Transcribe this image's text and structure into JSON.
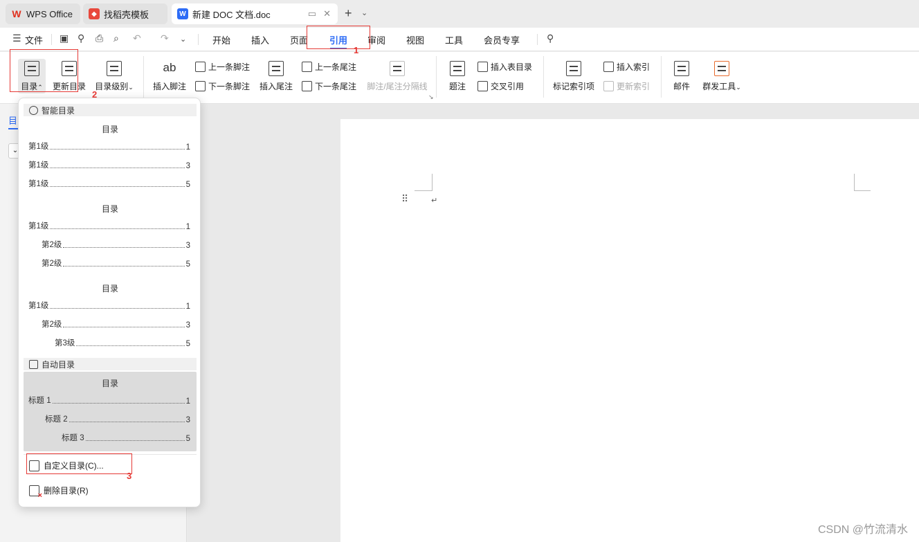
{
  "tabs": [
    {
      "label": "WPS Office",
      "icon": "wps-logo-icon"
    },
    {
      "label": "找稻壳模板",
      "icon": "daoke-logo-icon"
    },
    {
      "label": "新建 DOC 文档.doc",
      "icon": "word-doc-icon"
    }
  ],
  "menubar": {
    "file_label": "文件",
    "items": [
      "开始",
      "插入",
      "页面",
      "引用",
      "审阅",
      "视图",
      "工具",
      "会员专享"
    ],
    "active_item": "引用"
  },
  "ribbon": {
    "toc_label": "目录",
    "update_toc_label": "更新目录",
    "toc_level_label": "目录级别",
    "insert_footnote_label": "插入脚注",
    "prev_footnote_label": "上一条脚注",
    "next_footnote_label": "下一条脚注",
    "insert_endnote_label": "插入尾注",
    "prev_endnote_label": "上一条尾注",
    "next_endnote_label": "下一条尾注",
    "separator_label": "脚注/尾注分隔线",
    "caption_label": "题注",
    "insert_table_of_figures_label": "插入表目录",
    "cross_reference_label": "交叉引用",
    "mark_index_label": "标记索引项",
    "insert_index_label": "插入索引",
    "update_index_label": "更新索引",
    "mail_label": "邮件",
    "mass_send_label": "群发工具",
    "footnote_icon_text": "ab"
  },
  "sidebar": {
    "title": "目"
  },
  "dropdown": {
    "smart_header": "智能目录",
    "smart_tocs": [
      {
        "title": "目录",
        "entries": [
          {
            "label": "第1级",
            "page": "1"
          },
          {
            "label": "第1级",
            "page": "3"
          },
          {
            "label": "第1级",
            "page": "5"
          }
        ]
      },
      {
        "title": "目录",
        "entries": [
          {
            "label": "第1级",
            "page": "1"
          },
          {
            "label": "第2级",
            "page": "3"
          },
          {
            "label": "第2级",
            "page": "5"
          }
        ]
      },
      {
        "title": "目录",
        "entries": [
          {
            "label": "第1级",
            "page": "1"
          },
          {
            "label": "第2级",
            "page": "3"
          },
          {
            "label": "第3级",
            "page": "5"
          }
        ]
      }
    ],
    "auto_header": "自动目录",
    "auto_toc": {
      "title": "目录",
      "entries": [
        {
          "label": "标题 1",
          "page": "1"
        },
        {
          "label": "标题 2",
          "page": "3"
        },
        {
          "label": "标题 3",
          "page": "5"
        }
      ]
    },
    "custom_toc_label": "自定义目录(C)...",
    "delete_toc_label": "删除目录(R)"
  },
  "annotations": [
    "1",
    "2",
    "3"
  ],
  "watermark": "CSDN @竹流清水",
  "colors": {
    "accent": "#2d6cf6",
    "annotation": "#e53935",
    "wps_red": "#e0301e"
  }
}
